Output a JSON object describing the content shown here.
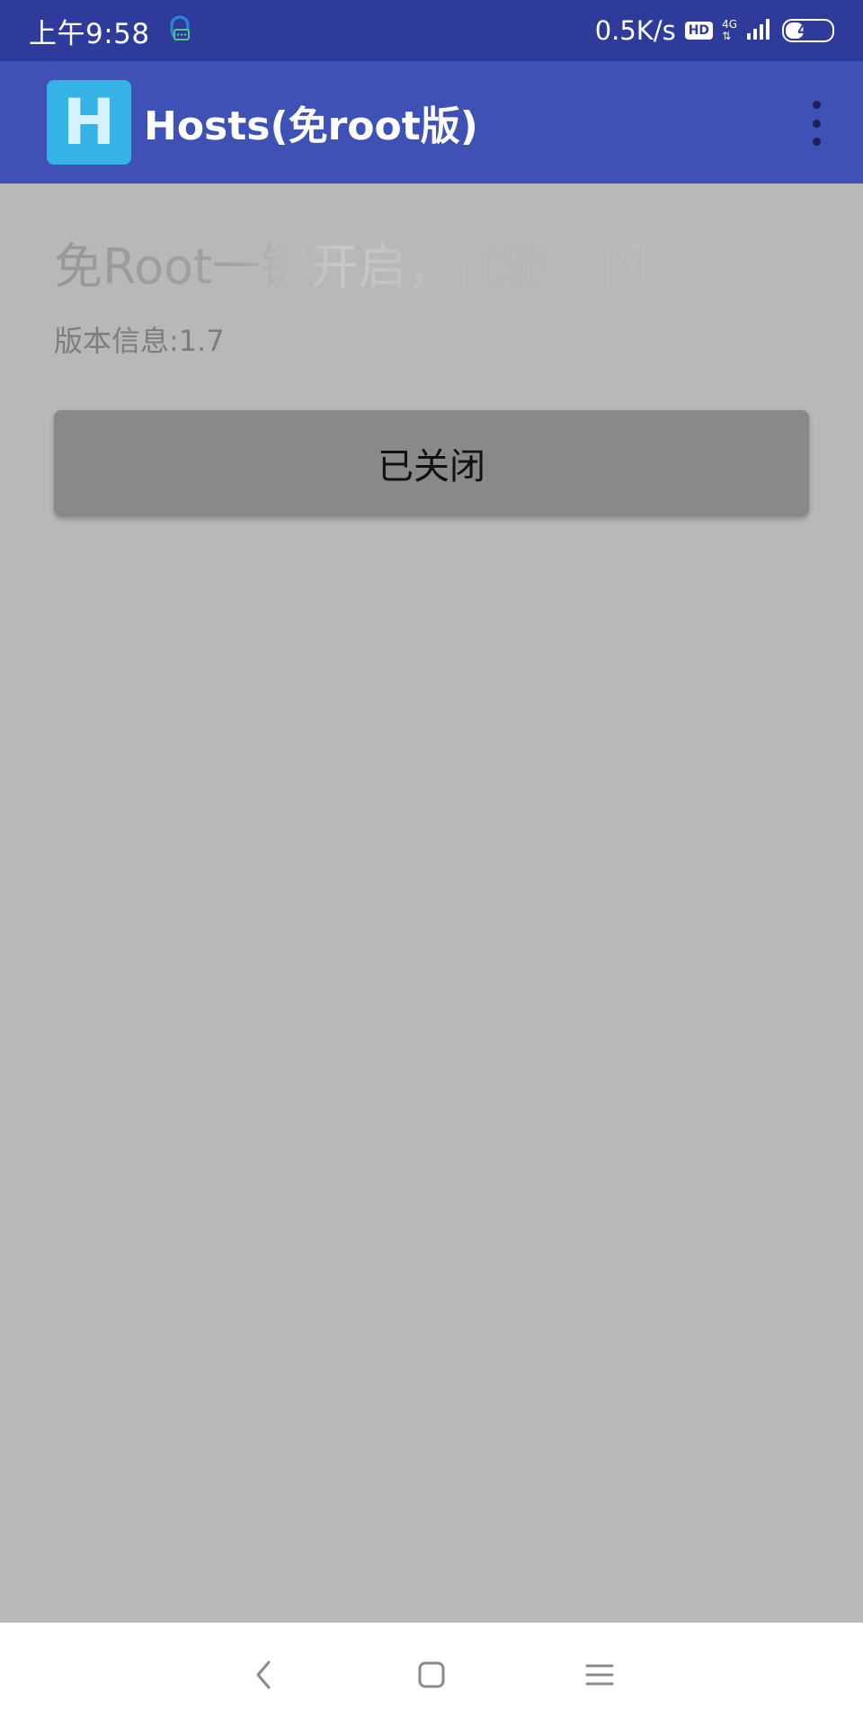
{
  "status_bar": {
    "time": "上午9:58",
    "net_speed": "0.5K/s",
    "hd_label": "HD",
    "net_type": "4G",
    "battery_level": "44",
    "battery_percent": 44
  },
  "app_bar": {
    "icon_letter": "H",
    "title": "Hosts(免root版)"
  },
  "main": {
    "headline": "免Root一键开启，优雅上网",
    "version_text": "版本信息:1.7",
    "toggle_label": "已关闭"
  },
  "nav_bar": {
    "icons": [
      "back-icon",
      "home-icon",
      "menu-icon"
    ]
  },
  "colors": {
    "status_bar": "#2f3b9b",
    "app_bar": "#3f51b5",
    "app_icon": "#36b3e6",
    "content_bg": "#b8b8b8",
    "toggle_button": "#898989"
  }
}
